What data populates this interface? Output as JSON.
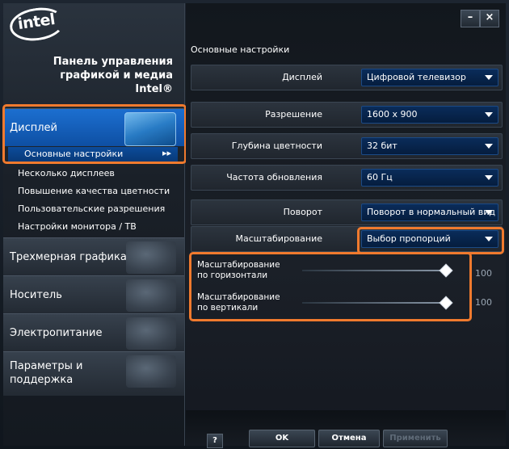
{
  "brand": {
    "logo_text": "intel",
    "panel_title_line1": "Панель управления",
    "panel_title_line2": "графикой и медиа",
    "panel_title_line3": "Intel®"
  },
  "window_controls": {
    "minimize": "–",
    "close": "×"
  },
  "sidebar": {
    "categories": [
      {
        "label": "Дисплей",
        "icon": "monitor-icon",
        "active": true
      },
      {
        "label": "Трехмерная графика",
        "icon": "3d-shapes-icon",
        "active": false
      },
      {
        "label": "Носитель",
        "icon": "media-player-icon",
        "active": false
      },
      {
        "label": "Электропитание",
        "icon": "power-flag-icon",
        "active": false
      },
      {
        "label": "Параметры и",
        "label2": "поддержка",
        "icon": "help-icon",
        "active": false
      }
    ],
    "display_subitems": [
      {
        "label": "Основные настройки",
        "selected": true,
        "arrow": "▸▸"
      },
      {
        "label": "Несколько дисплеев"
      },
      {
        "label": "Повышение качества цветности"
      },
      {
        "label": "Пользовательские разрешения"
      },
      {
        "label": "Настройки монитора / ТВ"
      }
    ]
  },
  "main": {
    "section_title": "Основные настройки",
    "settings": [
      {
        "label": "Дисплей",
        "value": "Цифровой телевизор"
      },
      {
        "label": "Разрешение",
        "value": "1600 x 900"
      },
      {
        "label": "Глубина цветности",
        "value": "32 бит"
      },
      {
        "label": "Частота обновления",
        "value": "60 Гц"
      },
      {
        "label": "Поворот",
        "value": "Поворот в нормальный вид"
      },
      {
        "label": "Масштабирование",
        "value": "Выбор пропорций"
      }
    ],
    "sliders": [
      {
        "label_line1": "Масштабирование",
        "label_line2": "по горизонтали",
        "value": "100",
        "level": 1.0
      },
      {
        "label_line1": "Масштабирование",
        "label_line2": "по вертикали",
        "value": "100",
        "level": 1.0
      }
    ]
  },
  "footer": {
    "help": "?",
    "ok": "OK",
    "cancel": "Отмена",
    "apply": "Применить"
  },
  "colors": {
    "accent_blue": "#1c6fd0",
    "highlight_orange": "#f07a2e",
    "dropdown_bg": "#0a2c5a"
  }
}
